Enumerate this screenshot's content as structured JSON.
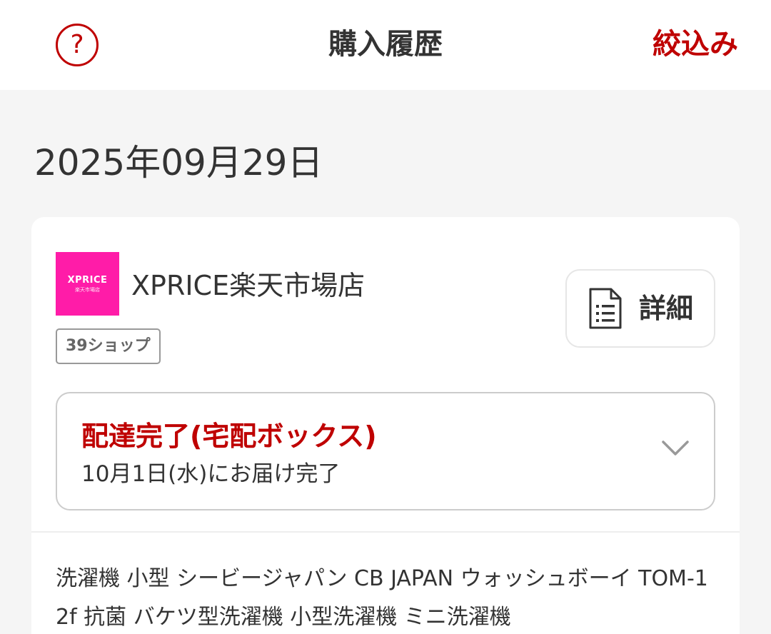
{
  "header": {
    "help_label": "?",
    "title": "購入履歴",
    "filter_label": "絞込み"
  },
  "order_date": "2025年09月29日",
  "order": {
    "shop": {
      "logo_text": "XPRICE",
      "logo_subtext": "楽天市場店",
      "name": "XPRICE楽天市場店",
      "badge": "39ショップ"
    },
    "detail_button_label": "詳細",
    "status": {
      "title": "配達完了(宅配ボックス)",
      "subtitle": "10月1日(水)にお届け完了"
    },
    "product_name": "洗濯機 小型 シービージャパン CB JAPAN ウォッシュボーイ TOM-12f 抗菌 バケツ型洗濯機 小型洗濯機 ミニ洗濯機"
  },
  "colors": {
    "accent": "#bf0000",
    "shop_logo_bg": "#ff1ca8",
    "background": "#f5f5f5"
  },
  "icons": {
    "help": "help-circle-icon",
    "detail": "document-icon",
    "expand": "chevron-down-icon"
  }
}
